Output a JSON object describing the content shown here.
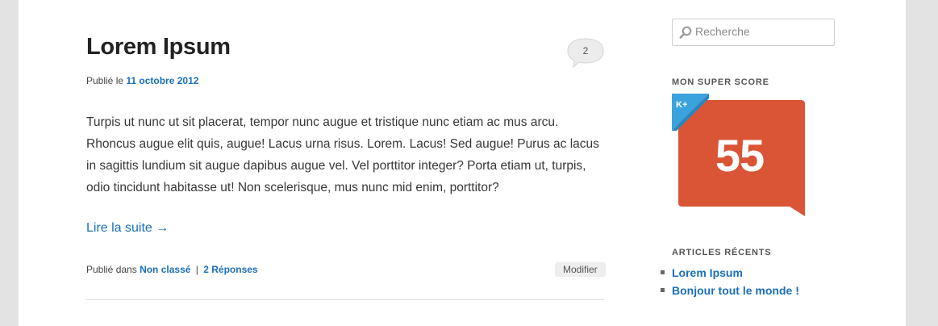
{
  "post": {
    "title": "Lorem Ipsum",
    "comment_count": "2",
    "published_prefix": "Publié le",
    "published_date": "11 octobre 2012",
    "body": "Turpis ut nunc ut sit placerat, tempor nunc augue et tristique nunc etiam ac mus arcu. Rhoncus augue elit quis, augue! Lacus urna risus. Lorem. Lacus! Sed augue! Purus ac lacus in sagittis lundium sit augue dapibus augue vel. Vel porttitor integer? Porta etiam ut, turpis, odio tincidunt habitasse ut! Non scelerisque, mus nunc mid enim, porttitor?",
    "read_more": "Lire la suite →",
    "footer_prefix": "Publié dans",
    "category": "Non classé",
    "separator": "|",
    "responses": "2 Réponses",
    "edit_label": "Modifier"
  },
  "sidebar": {
    "search_placeholder": "Recherche",
    "score_widget_title": "MON SUPER SCORE",
    "score_value": "55",
    "score_badge_label": "K+",
    "recent_title": "ARTICLES RÉCENTS",
    "recent_posts": [
      "Lorem Ipsum",
      "Bonjour tout le monde !"
    ]
  },
  "colors": {
    "link": "#1b6fb8",
    "score_badge": "#d95535",
    "kplus_corner": "#3aa2dc"
  }
}
